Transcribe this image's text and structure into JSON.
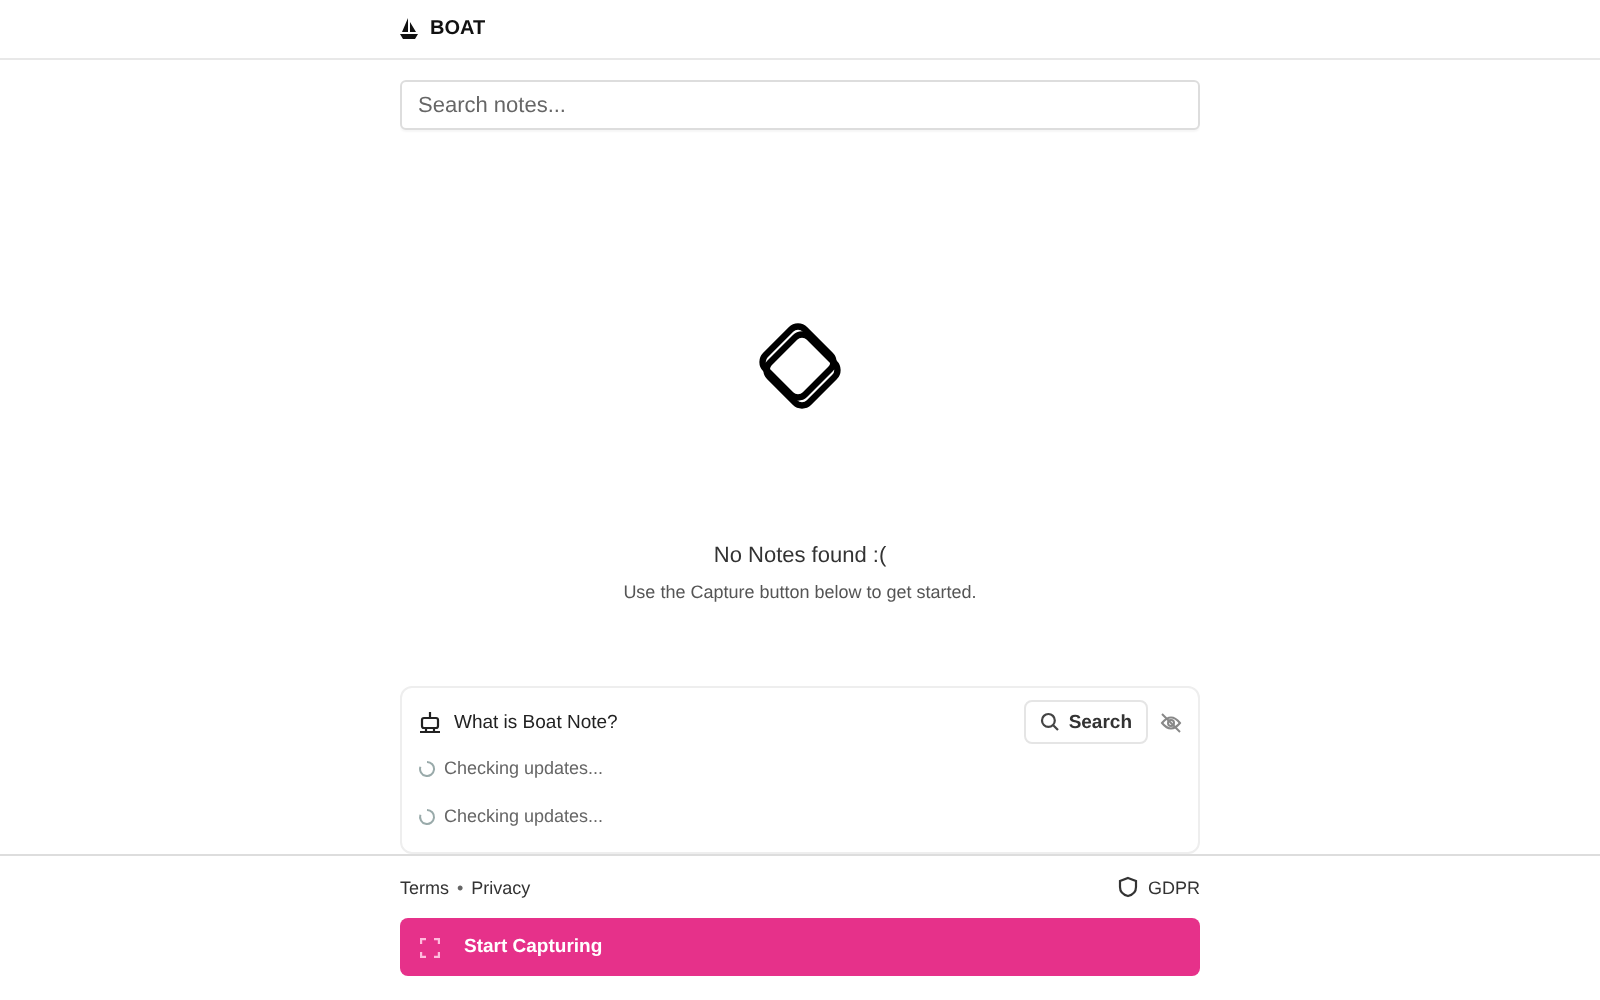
{
  "brand": "BOAT",
  "search": {
    "placeholder": "Search notes..."
  },
  "empty_state": {
    "title": "No Notes found :(",
    "subtitle": "Use the Capture button below to get started."
  },
  "info_card": {
    "title": "What is Boat Note?",
    "search_button": "Search",
    "updates": [
      "Checking updates...",
      "Checking updates..."
    ]
  },
  "footer": {
    "links": [
      "Terms",
      "Privacy"
    ],
    "separator": "•",
    "gdpr": "GDPR",
    "capture_button": "Start Capturing"
  }
}
